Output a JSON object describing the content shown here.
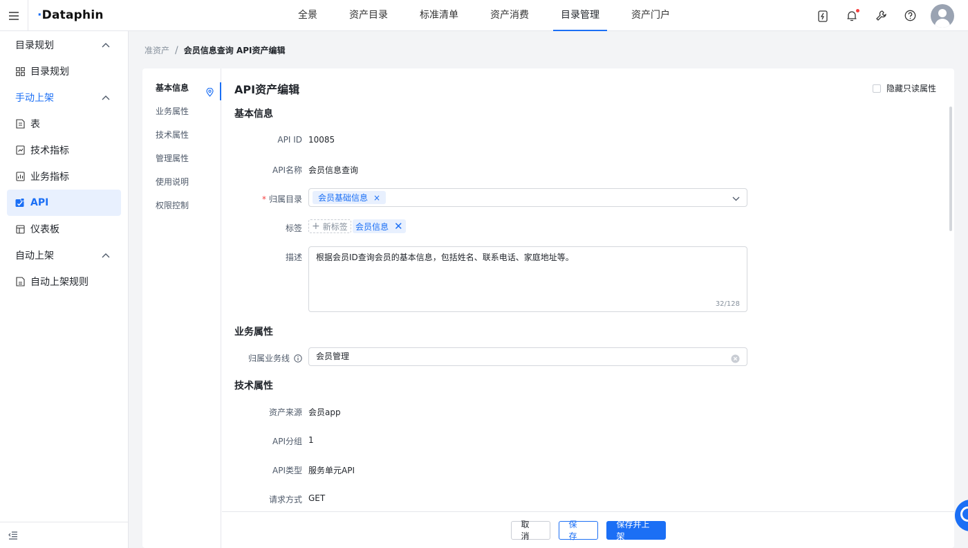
{
  "app": {
    "logo": "Dataphin"
  },
  "topnav": {
    "items": [
      "全景",
      "资产目录",
      "标准清单",
      "资产消费",
      "目录管理",
      "资产门户"
    ],
    "active_index": 4
  },
  "sidebar": {
    "groups": [
      {
        "label": "目录规划",
        "items": [
          {
            "label": "目录规划",
            "icon": "grid-icon"
          }
        ]
      },
      {
        "label": "手动上架",
        "items": [
          {
            "label": "表",
            "icon": "table-doc-icon"
          },
          {
            "label": "技术指标",
            "icon": "metric-doc-icon"
          },
          {
            "label": "业务指标",
            "icon": "biz-metric-icon"
          },
          {
            "label": "API",
            "icon": "api-icon"
          },
          {
            "label": "仪表板",
            "icon": "dashboard-icon"
          }
        ]
      },
      {
        "label": "自动上架",
        "items": [
          {
            "label": "自动上架规则",
            "icon": "rule-doc-icon"
          }
        ]
      }
    ]
  },
  "breadcrumb": {
    "parent": "准资产",
    "current": "会员信息查询 API资产编辑"
  },
  "anchors": [
    "基本信息",
    "业务属性",
    "技术属性",
    "管理属性",
    "使用说明",
    "权限控制"
  ],
  "page": {
    "title": "API资产编辑",
    "readonly_toggle": "隐藏只读属性"
  },
  "basic": {
    "section_title": "基本信息",
    "api_id_label": "API ID",
    "api_id_value": "10085",
    "api_name_label": "API名称",
    "api_name_value": "会员信息查询",
    "catalog_label": "归属目录",
    "catalog_value": "会员基础信息",
    "tag_label": "标签",
    "new_tag": "新标签",
    "tag_value": "会员信息",
    "desc_label": "描述",
    "desc_value": "根据会员ID查询会员的基本信息，包括姓名、联系电话、家庭地址等。",
    "desc_counter": "32/128"
  },
  "business": {
    "section_title": "业务属性",
    "line_label": "归属业务线",
    "line_value": "会员管理"
  },
  "tech": {
    "section_title": "技术属性",
    "source_label": "资产来源",
    "source_value": "会员app",
    "group_label": "API分组",
    "group_value": "1",
    "type_label": "API类型",
    "type_value": "服务单元API",
    "method_label": "请求方式",
    "method_value": "GET"
  },
  "footer": {
    "cancel": "取 消",
    "save": "保 存",
    "save_publish": "保存并上架"
  },
  "colors": {
    "accent": "#1b6ff5",
    "danger": "#f53f3f"
  }
}
